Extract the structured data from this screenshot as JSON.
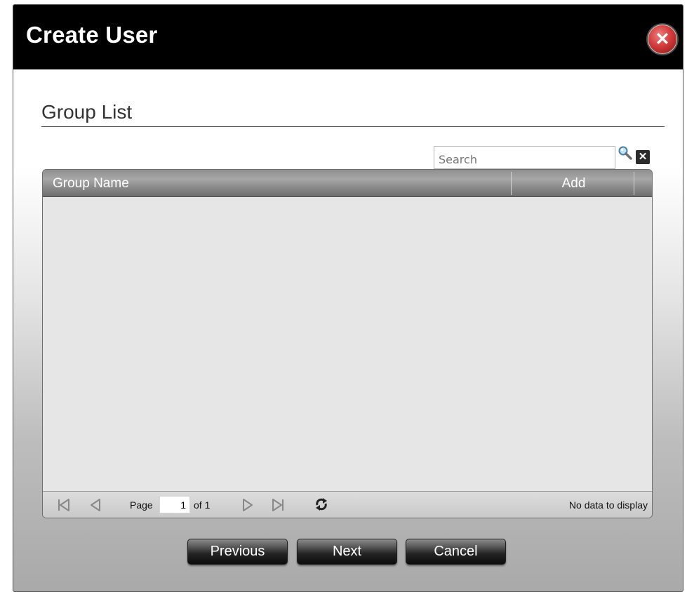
{
  "dialog": {
    "title": "Create User",
    "close_icon": "close-icon"
  },
  "section": {
    "title": "Group List"
  },
  "search": {
    "placeholder": "Search",
    "search_icon": "magnifier-icon",
    "clear_icon": "clear-icon"
  },
  "grid": {
    "columns": [
      "Group Name",
      "Add"
    ],
    "rows": []
  },
  "pager": {
    "page_label": "Page",
    "page_value": "1",
    "of_label": "of 1",
    "status": "No data to display",
    "icons": [
      "first-page-icon",
      "previous-page-icon",
      "next-page-icon",
      "last-page-icon",
      "refresh-icon"
    ]
  },
  "buttons": {
    "previous": "Previous",
    "next": "Next",
    "cancel": "Cancel"
  },
  "colors": {
    "titlebar": "#000000",
    "close_button": "#d23c3c",
    "grid_body": "#e6e6e6"
  }
}
